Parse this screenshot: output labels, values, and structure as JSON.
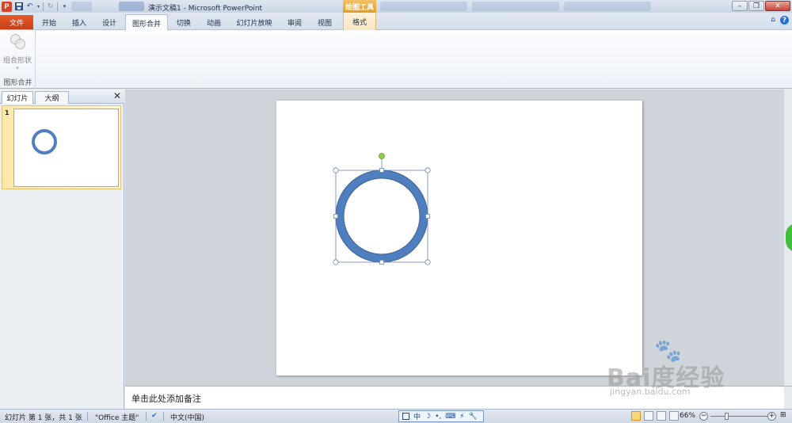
{
  "app": {
    "title": "演示文稿1 - Microsoft PowerPoint",
    "app_icon_letter": "P",
    "contextual_group": "绘图工具"
  },
  "qat": {
    "save_icon": "save-icon",
    "undo_icon": "undo-icon",
    "redo_icon": "redo-icon",
    "customize_icon": "customize-qat-icon"
  },
  "window_controls": {
    "minimize": "–",
    "restore": "❐",
    "close": "✕"
  },
  "tabs": [
    {
      "label": "文件"
    },
    {
      "label": "开始"
    },
    {
      "label": "插入"
    },
    {
      "label": "设计"
    },
    {
      "label": "图形合并"
    },
    {
      "label": "切换"
    },
    {
      "label": "动画"
    },
    {
      "label": "幻灯片放映"
    },
    {
      "label": "审阅"
    },
    {
      "label": "视图"
    },
    {
      "label": "格式"
    }
  ],
  "ribbon": {
    "combine_shapes_label": "组合形状",
    "group_label": "图形合并"
  },
  "left_panel": {
    "tab_slides": "幻灯片",
    "tab_outline": "大纲",
    "close": "✕",
    "slide_number": "1"
  },
  "notes": {
    "placeholder": "单击此处添加备注"
  },
  "status": {
    "slide_info": "幻灯片 第 1 张，共 1 张",
    "theme": "\"Office 主题\"",
    "language": "中文(中国)",
    "zoom": "66%"
  },
  "ime": {
    "mode": "中",
    "symbols": [
      "☽",
      "•,",
      "⌨",
      "⚡",
      "🔧"
    ]
  },
  "colors": {
    "file_tab": "#d24726",
    "circle_fill": "#4f7fbe",
    "circle_stroke": "#3a6299",
    "rotation_handle": "#8fd14f"
  },
  "watermark": {
    "brand": "Bai度经验",
    "url": "jingyan.baidu.com"
  }
}
